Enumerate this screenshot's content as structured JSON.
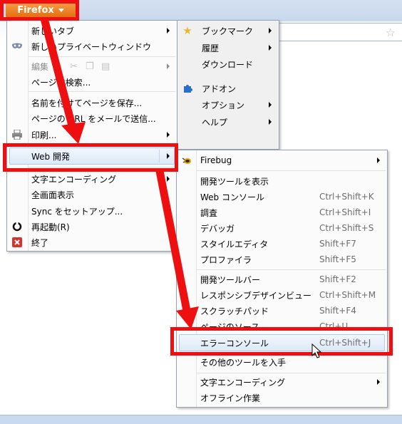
{
  "app_button": {
    "label": "Firefox"
  },
  "main_menu": {
    "items": [
      {
        "label": "新しいタブ",
        "submenu": true
      },
      {
        "label": "新しいプライベートウィンドウ",
        "icon": "mask-icon"
      },
      {
        "label": "編集",
        "submenu": true,
        "disabled": true
      },
      {
        "label": "ページ内検索..."
      },
      {
        "label": "名前を付けてページを保存..."
      },
      {
        "label": "ページの URL をメールで送信..."
      },
      {
        "label": "印刷...",
        "submenu": true,
        "icon": "printer-icon"
      },
      {
        "label": "Web 開発",
        "submenu": true,
        "highlighted": true
      },
      {
        "label": "文字エンコーディング",
        "submenu": true
      },
      {
        "label": "全画面表示"
      },
      {
        "label": "Sync をセットアップ..."
      },
      {
        "label": "再起動(R)",
        "icon": "restart-icon"
      },
      {
        "label": "終了",
        "icon": "exit-icon"
      }
    ]
  },
  "right_menu": {
    "items": [
      {
        "label": "ブックマーク",
        "submenu": true,
        "icon": "star-icon"
      },
      {
        "label": "履歴",
        "submenu": true
      },
      {
        "label": "ダウンロード"
      },
      {
        "label": "アドオン",
        "icon": "puzzle-icon"
      },
      {
        "label": "オプション",
        "submenu": true
      },
      {
        "label": "ヘルプ",
        "submenu": true
      }
    ]
  },
  "dev_menu": {
    "items": [
      {
        "label": "Firebug",
        "submenu": true,
        "icon": "firebug-icon"
      },
      {
        "label": "開発ツールを表示"
      },
      {
        "label": "Web コンソール",
        "shortcut": "Ctrl+Shift+K"
      },
      {
        "label": "調査",
        "shortcut": "Ctrl+Shift+I"
      },
      {
        "label": "デバッガ",
        "shortcut": "Ctrl+Shift+S"
      },
      {
        "label": "スタイルエディタ",
        "shortcut": "Shift+F7"
      },
      {
        "label": "プロファイラ",
        "shortcut": "Shift+F5"
      },
      {
        "label": "開発ツールバー",
        "shortcut": "Shift+F2"
      },
      {
        "label": "レスポンシブデザインビュー",
        "shortcut": "Ctrl+Shift+M"
      },
      {
        "label": "スクラッチパッド",
        "shortcut": "Shift+F4"
      },
      {
        "label": "ページのソース",
        "shortcut": "Ctrl+U"
      },
      {
        "label": "エラーコンソール",
        "shortcut": "Ctrl+Shift+J",
        "highlighted": true
      },
      {
        "label": "その他のツールを入手"
      },
      {
        "label": "文字エンコーディング",
        "submenu": true
      },
      {
        "label": "オフライン作業"
      }
    ]
  },
  "colors": {
    "annotation_red": "#ee1010",
    "firefox_orange": "#e8730f"
  }
}
